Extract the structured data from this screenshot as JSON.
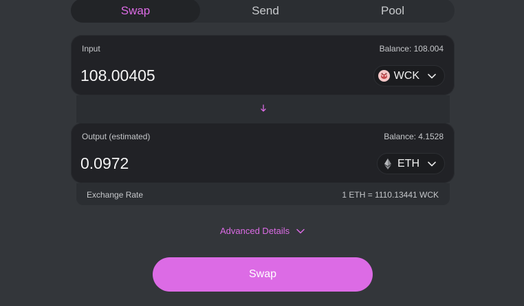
{
  "tabs": [
    {
      "label": "Swap",
      "active": true
    },
    {
      "label": "Send",
      "active": false
    },
    {
      "label": "Pool",
      "active": false
    }
  ],
  "input": {
    "label": "Input",
    "balance": "Balance: 108.004",
    "amount": "108.00405",
    "token": {
      "symbol": "WCK",
      "icon": "wck-token-icon"
    }
  },
  "output": {
    "label": "Output (estimated)",
    "balance": "Balance: 4.1528",
    "amount": "0.0972",
    "token": {
      "symbol": "ETH",
      "icon": "eth-token-icon"
    }
  },
  "exchange_rate": {
    "label": "Exchange Rate",
    "value": "1 ETH = 1110.13441 WCK"
  },
  "advanced_details": {
    "label": "Advanced Details",
    "icon": "chevron-down-icon"
  },
  "swap_button": {
    "label": "Swap"
  },
  "colors": {
    "accent": "#dc6be5",
    "background": "#33363a",
    "panel": "#212226"
  }
}
